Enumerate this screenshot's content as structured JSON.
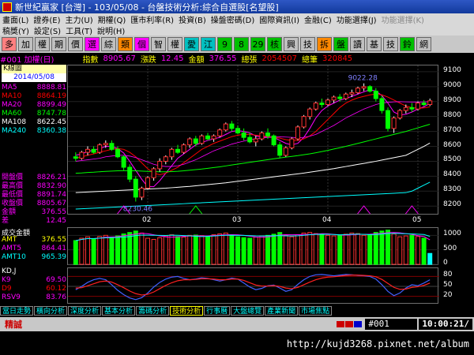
{
  "window_title": "新世紀贏家 [台灣] - 103/05/08 - 台盤技術分析:綜合自選股[名望股]",
  "menu_row1": [
    "畫面(L)",
    "證券(E)",
    "主力(U)",
    "期權(Q)",
    "匯市利率(R)",
    "投資(B)",
    "操盤密碼(D)",
    "國際資訊(I)",
    "金融(C)",
    "功能選擇(J)",
    "功能選擇(K)"
  ],
  "menu_row2": [
    "稿獎(Y)",
    "設定(S)",
    "工具(T)",
    "說明(H)"
  ],
  "toolbar_buttons": [
    {
      "label": "多",
      "color": "#ff8080"
    },
    {
      "label": "加",
      "color": "#c0c0c0"
    },
    {
      "label": "權",
      "color": "#c0c0c0"
    },
    {
      "label": "期",
      "color": "#c0c0c0"
    },
    {
      "label": "價",
      "color": "#c0c0c0"
    },
    {
      "label": "選",
      "color": "#ff00ff"
    },
    {
      "label": "綜",
      "color": "#c0c0c0"
    },
    {
      "label": "類",
      "color": "#ff8800"
    },
    {
      "label": "個",
      "color": "#ff00ff"
    },
    {
      "label": "智",
      "color": "#c0c0c0"
    },
    {
      "label": "權",
      "color": "#c0c0c0"
    },
    {
      "label": "愛",
      "color": "#00c0c0"
    },
    {
      "label": "江",
      "color": "#00c0c0"
    },
    {
      "label": "9",
      "color": "#00c000"
    },
    {
      "label": "8",
      "color": "#00c000"
    },
    {
      "label": "29",
      "color": "#00c000"
    },
    {
      "label": "核",
      "color": "#00c000"
    },
    {
      "label": "興",
      "color": "#c0c0c0"
    },
    {
      "label": "技",
      "color": "#c0c0c0"
    },
    {
      "label": "拆",
      "color": "#ff8800"
    },
    {
      "label": "盤",
      "color": "#00c000"
    },
    {
      "label": "讀",
      "color": "#c0c0c0"
    },
    {
      "label": "基",
      "color": "#c0c0c0"
    },
    {
      "label": "技",
      "color": "#c0c0c0"
    },
    {
      "label": "鈴",
      "color": "#00c000"
    },
    {
      "label": "網",
      "color": "#c0c0c0"
    }
  ],
  "info": {
    "code": "#001 加權(日)",
    "index_label": "指數",
    "index_value": "8905.67",
    "change_label": "漲跌",
    "change_value": "12.45",
    "amount_label": "金額",
    "amount_value": "376.55",
    "vol_label": "總張",
    "vol_value": "2054507",
    "count_label": "總筆",
    "count_value": "320845"
  },
  "kline_title": "K線圖",
  "kline_date": "2014/05/08",
  "ma_legend": [
    {
      "label": "MA5",
      "value": "8888.81",
      "color": "#ff00ff"
    },
    {
      "label": "MA10",
      "value": "8864.19",
      "color": "#ff0000"
    },
    {
      "label": "MA20",
      "value": "8899.49",
      "color": "#ff00ff"
    },
    {
      "label": "MA60",
      "value": "8747.78",
      "color": "#00ff00"
    },
    {
      "label": "MA108",
      "value": "8622.45",
      "color": "#ffffff"
    },
    {
      "label": "MA240",
      "value": "8360.38",
      "color": "#00ffff"
    }
  ],
  "price_legend": [
    {
      "label": "開盤價",
      "value": "8826.21",
      "color": "#ff00ff"
    },
    {
      "label": "最高價",
      "value": "8832.90",
      "color": "#ff00ff"
    },
    {
      "label": "最低價",
      "value": "8891.74",
      "color": "#ff00ff"
    },
    {
      "label": "收盤價",
      "value": "8805.67",
      "color": "#ff00ff"
    },
    {
      "label": "金額",
      "value": "376.55",
      "color": "#ff00ff"
    },
    {
      "label": "差",
      "value": "12.45",
      "color": "#ff00ff"
    }
  ],
  "annotations": {
    "high": "9022.28",
    "low": "8230.46"
  },
  "volume_title": "成交金額",
  "vol_legend": [
    {
      "label": "AMT",
      "value": "376.55",
      "color": "#ffff00"
    },
    {
      "label": "AMT5",
      "value": "864.41",
      "color": "#ff00ff"
    },
    {
      "label": "AMT10",
      "value": "965.39",
      "color": "#00ffff"
    }
  ],
  "kdj_title": "KD,J",
  "kdj_legend": [
    {
      "label": "K9",
      "value": "69.50",
      "color": "#ff00ff"
    },
    {
      "label": "D9",
      "value": "60.12",
      "color": "#ff0000"
    },
    {
      "label": "RSV9",
      "value": "83.76",
      "color": "#ff00ff"
    }
  ],
  "bottom_tabs": [
    "當日走勢",
    "橫向分析",
    "深度分析",
    "基本分析",
    "籌碼分析",
    "技術分析",
    "行事曆",
    "大盤總覽",
    "產業新聞",
    "市場焦點"
  ],
  "status": {
    "left": "精誠",
    "code": "#001",
    "time": "10:00:21/"
  },
  "footer_url": "http://kujd3268.pixnet.net/album",
  "chart_data": {
    "type": "candlestick",
    "x_labels": [
      "02",
      "03",
      "04",
      "05"
    ],
    "price_yticks": [
      9100,
      9000,
      8900,
      8800,
      8700,
      8600,
      8500,
      8400,
      8300,
      8200
    ],
    "price_ylim": [
      8180,
      9110
    ],
    "candles": [
      {
        "o": 8530,
        "h": 8560,
        "l": 8500,
        "c": 8520
      },
      {
        "o": 8520,
        "h": 8570,
        "l": 8510,
        "c": 8560
      },
      {
        "o": 8560,
        "h": 8600,
        "l": 8540,
        "c": 8580
      },
      {
        "o": 8580,
        "h": 8600,
        "l": 8550,
        "c": 8560
      },
      {
        "o": 8560,
        "h": 8620,
        "l": 8550,
        "c": 8610
      },
      {
        "o": 8610,
        "h": 8640,
        "l": 8590,
        "c": 8620
      },
      {
        "o": 8620,
        "h": 8640,
        "l": 8570,
        "c": 8580
      },
      {
        "o": 8580,
        "h": 8600,
        "l": 8520,
        "c": 8530
      },
      {
        "o": 8530,
        "h": 8540,
        "l": 8440,
        "c": 8460
      },
      {
        "o": 8460,
        "h": 8480,
        "l": 8360,
        "c": 8380
      },
      {
        "o": 8380,
        "h": 8400,
        "l": 8230,
        "c": 8260
      },
      {
        "o": 8260,
        "h": 8330,
        "l": 8240,
        "c": 8320
      },
      {
        "o": 8320,
        "h": 8400,
        "l": 8310,
        "c": 8390
      },
      {
        "o": 8390,
        "h": 8460,
        "l": 8370,
        "c": 8450
      },
      {
        "o": 8450,
        "h": 8520,
        "l": 8430,
        "c": 8500
      },
      {
        "o": 8500,
        "h": 8540,
        "l": 8480,
        "c": 8530
      },
      {
        "o": 8530,
        "h": 8590,
        "l": 8510,
        "c": 8580
      },
      {
        "o": 8580,
        "h": 8610,
        "l": 8550,
        "c": 8560
      },
      {
        "o": 8560,
        "h": 8620,
        "l": 8550,
        "c": 8610
      },
      {
        "o": 8610,
        "h": 8660,
        "l": 8590,
        "c": 8650
      },
      {
        "o": 8650,
        "h": 8670,
        "l": 8600,
        "c": 8620
      },
      {
        "o": 8620,
        "h": 8680,
        "l": 8610,
        "c": 8670
      },
      {
        "o": 8670,
        "h": 8690,
        "l": 8640,
        "c": 8650
      },
      {
        "o": 8650,
        "h": 8680,
        "l": 8630,
        "c": 8670
      },
      {
        "o": 8670,
        "h": 8720,
        "l": 8660,
        "c": 8710
      },
      {
        "o": 8710,
        "h": 8760,
        "l": 8700,
        "c": 8750
      },
      {
        "o": 8750,
        "h": 8770,
        "l": 8700,
        "c": 8720
      },
      {
        "o": 8720,
        "h": 8740,
        "l": 8680,
        "c": 8690
      },
      {
        "o": 8690,
        "h": 8720,
        "l": 8640,
        "c": 8660
      },
      {
        "o": 8660,
        "h": 8690,
        "l": 8620,
        "c": 8630
      },
      {
        "o": 8630,
        "h": 8670,
        "l": 8600,
        "c": 8650
      },
      {
        "o": 8650,
        "h": 8700,
        "l": 8640,
        "c": 8690
      },
      {
        "o": 8690,
        "h": 8720,
        "l": 8650,
        "c": 8670
      },
      {
        "o": 8670,
        "h": 8680,
        "l": 8600,
        "c": 8610
      },
      {
        "o": 8610,
        "h": 8630,
        "l": 8520,
        "c": 8540
      },
      {
        "o": 8540,
        "h": 8600,
        "l": 8530,
        "c": 8590
      },
      {
        "o": 8590,
        "h": 8660,
        "l": 8580,
        "c": 8650
      },
      {
        "o": 8650,
        "h": 8740,
        "l": 8640,
        "c": 8730
      },
      {
        "o": 8730,
        "h": 8810,
        "l": 8720,
        "c": 8800
      },
      {
        "o": 8800,
        "h": 8860,
        "l": 8780,
        "c": 8850
      },
      {
        "o": 8850,
        "h": 8900,
        "l": 8840,
        "c": 8890
      },
      {
        "o": 8890,
        "h": 8920,
        "l": 8860,
        "c": 8880
      },
      {
        "o": 8880,
        "h": 8920,
        "l": 8870,
        "c": 8910
      },
      {
        "o": 8910,
        "h": 8940,
        "l": 8890,
        "c": 8930
      },
      {
        "o": 8930,
        "h": 8950,
        "l": 8900,
        "c": 8920
      },
      {
        "o": 8920,
        "h": 8960,
        "l": 8910,
        "c": 8950
      },
      {
        "o": 8950,
        "h": 8980,
        "l": 8930,
        "c": 8960
      },
      {
        "o": 8960,
        "h": 9000,
        "l": 8950,
        "c": 8990
      },
      {
        "o": 8990,
        "h": 9022,
        "l": 8970,
        "c": 9000
      },
      {
        "o": 9000,
        "h": 9010,
        "l": 8960,
        "c": 8970
      },
      {
        "o": 8970,
        "h": 8990,
        "l": 8900,
        "c": 8920
      },
      {
        "o": 8920,
        "h": 8940,
        "l": 8820,
        "c": 8840
      },
      {
        "o": 8840,
        "h": 8860,
        "l": 8700,
        "c": 8720
      },
      {
        "o": 8720,
        "h": 8800,
        "l": 8690,
        "c": 8790
      },
      {
        "o": 8790,
        "h": 8850,
        "l": 8780,
        "c": 8840
      },
      {
        "o": 8840,
        "h": 8880,
        "l": 8820,
        "c": 8860
      },
      {
        "o": 8860,
        "h": 8890,
        "l": 8830,
        "c": 8850
      },
      {
        "o": 8850,
        "h": 8900,
        "l": 8840,
        "c": 8890
      },
      {
        "o": 8890,
        "h": 8910,
        "l": 8870,
        "c": 8880
      },
      {
        "o": 8880,
        "h": 8920,
        "l": 8870,
        "c": 8905
      }
    ],
    "ma_lines": {
      "MA5": [
        8540,
        8550,
        8565,
        8575,
        8585,
        8600,
        8600,
        8585,
        8555,
        8500,
        8440,
        8380,
        8330,
        8330,
        8370,
        8420,
        8470,
        8520,
        8550,
        8580,
        8610,
        8625,
        8640,
        8650,
        8660,
        8680,
        8700,
        8705,
        8700,
        8690,
        8670,
        8660,
        8665,
        8660,
        8640,
        8620,
        8610,
        8620,
        8660,
        8720,
        8790,
        8840,
        8870,
        8890,
        8910,
        8920,
        8935,
        8950,
        8965,
        8980,
        8970,
        8940,
        8890,
        8830,
        8810,
        8815,
        8830,
        8850,
        8865,
        8888
      ],
      "MA10": [
        8520,
        8530,
        8540,
        8550,
        8560,
        8570,
        8580,
        8585,
        8580,
        8560,
        8530,
        8490,
        8450,
        8420,
        8410,
        8420,
        8440,
        8460,
        8490,
        8520,
        8550,
        8580,
        8600,
        8620,
        8635,
        8650,
        8665,
        8675,
        8680,
        8680,
        8675,
        8670,
        8665,
        8660,
        8655,
        8645,
        8640,
        8640,
        8650,
        8670,
        8700,
        8740,
        8780,
        8820,
        8860,
        8890,
        8910,
        8925,
        8935,
        8945,
        8950,
        8945,
        8930,
        8910,
        8890,
        8870,
        8860,
        8855,
        8858,
        8864
      ],
      "MA20": [
        8500,
        8505,
        8510,
        8515,
        8520,
        8530,
        8535,
        8540,
        8540,
        8535,
        8525,
        8510,
        8495,
        8480,
        8470,
        8465,
        8465,
        8470,
        8480,
        8495,
        8510,
        8530,
        8550,
        8570,
        8585,
        8600,
        8615,
        8625,
        8635,
        8645,
        8650,
        8655,
        8660,
        8662,
        8664,
        8662,
        8660,
        8658,
        8660,
        8668,
        8680,
        8700,
        8720,
        8740,
        8765,
        8790,
        8810,
        8830,
        8850,
        8865,
        8880,
        8890,
        8895,
        8898,
        8899,
        8898,
        8897,
        8897,
        8898,
        8899
      ],
      "MA60": [
        8420,
        8422,
        8425,
        8427,
        8430,
        8432,
        8434,
        8436,
        8437,
        8437,
        8436,
        8434,
        8432,
        8431,
        8430,
        8430,
        8431,
        8433,
        8436,
        8440,
        8444,
        8448,
        8453,
        8458,
        8463,
        8469,
        8475,
        8481,
        8487,
        8493,
        8499,
        8505,
        8511,
        8517,
        8522,
        8528,
        8533,
        8538,
        8544,
        8550,
        8557,
        8565,
        8573,
        8582,
        8591,
        8600,
        8610,
        8620,
        8630,
        8640,
        8650,
        8660,
        8670,
        8680,
        8690,
        8700,
        8712,
        8724,
        8736,
        8748
      ],
      "MA108": [
        8290,
        8292,
        8294,
        8296,
        8298,
        8300,
        8302,
        8304,
        8306,
        8308,
        8310,
        8312,
        8314,
        8316,
        8318,
        8320,
        8323,
        8326,
        8329,
        8332,
        8336,
        8340,
        8344,
        8348,
        8352,
        8356,
        8361,
        8366,
        8371,
        8376,
        8381,
        8386,
        8391,
        8396,
        8401,
        8406,
        8411,
        8416,
        8421,
        8427,
        8433,
        8439,
        8445,
        8451,
        8458,
        8465,
        8472,
        8479,
        8486,
        8493,
        8500,
        8508,
        8516,
        8524,
        8532,
        8540,
        8560,
        8580,
        8600,
        8622
      ],
      "MA240": [
        8180,
        8182,
        8184,
        8186,
        8188,
        8190,
        8192,
        8194,
        8196,
        8198,
        8200,
        8202,
        8204,
        8206,
        8208,
        8210,
        8212,
        8214,
        8216,
        8218,
        8220,
        8222,
        8224,
        8226,
        8228,
        8230,
        8232,
        8234,
        8236,
        8238,
        8240,
        8242,
        8244,
        8246,
        8248,
        8250,
        8252,
        8254,
        8256,
        8258,
        8260,
        8262,
        8264,
        8266,
        8268,
        8270,
        8272,
        8274,
        8276,
        8278,
        8280,
        8282,
        8284,
        8286,
        8288,
        8290,
        8300,
        8320,
        8340,
        8360
      ]
    },
    "volume_yticks": [
      1000,
      500,
      0
    ],
    "volume_ylim": [
      0,
      1200
    ],
    "volume": [
      820,
      900,
      950,
      880,
      960,
      1000,
      940,
      980,
      1050,
      1100,
      1150,
      1080,
      900,
      860,
      920,
      980,
      1020,
      960,
      940,
      1000,
      1010,
      990,
      960,
      1020,
      1050,
      1080,
      1000,
      950,
      920,
      900,
      940,
      980,
      1000,
      1040,
      1100,
      1000,
      950,
      1020,
      1080,
      1100,
      1060,
      1020,
      1000,
      980,
      1000,
      1040,
      1080,
      1060,
      1000,
      1020,
      1100,
      1150,
      1180,
      1050,
      950,
      980,
      1000,
      960,
      900,
      376
    ],
    "kd_yticks": [
      80,
      50,
      20
    ],
    "kd_ylim": [
      0,
      100
    ],
    "K": [
      40,
      50,
      62,
      70,
      74,
      70,
      55,
      38,
      25,
      15,
      10,
      16,
      30,
      48,
      62,
      72,
      78,
      80,
      74,
      70,
      72,
      76,
      74,
      70,
      66,
      70,
      75,
      72,
      60,
      48,
      40,
      44,
      52,
      54,
      45,
      35,
      40,
      56,
      70,
      80,
      85,
      86,
      84,
      82,
      84,
      86,
      85,
      83,
      82,
      80,
      72,
      55,
      35,
      22,
      30,
      45,
      55,
      52,
      60,
      70
    ],
    "D": [
      45,
      46,
      52,
      58,
      64,
      66,
      63,
      55,
      46,
      36,
      28,
      24,
      26,
      33,
      43,
      53,
      61,
      67,
      70,
      70,
      71,
      73,
      73,
      72,
      70,
      70,
      72,
      72,
      68,
      61,
      54,
      51,
      51,
      52,
      50,
      45,
      43,
      47,
      55,
      63,
      70,
      75,
      78,
      79,
      81,
      83,
      84,
      84,
      83,
      82,
      79,
      71,
      59,
      47,
      41,
      42,
      47,
      49,
      53,
      60
    ]
  }
}
